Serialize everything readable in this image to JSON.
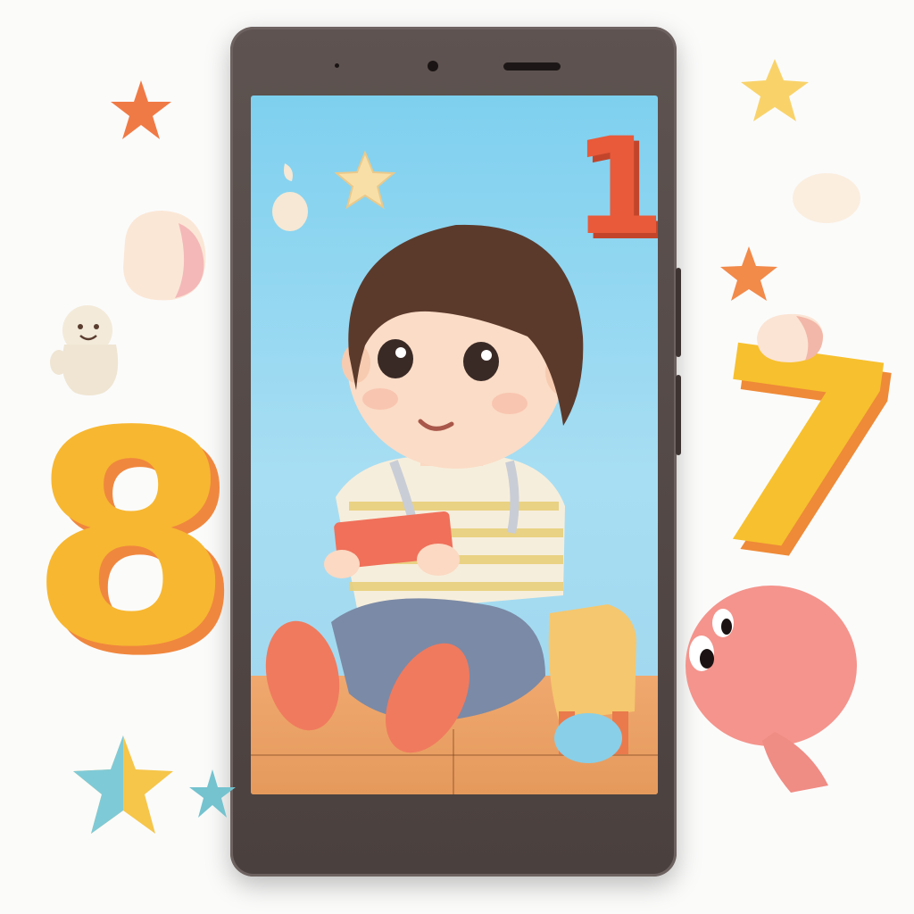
{
  "scene": {
    "description_colors": {
      "background": "#fbfbfa",
      "phone_body": "#4a403e",
      "screen_sky": "#8fd5f0",
      "floor": "#eca064",
      "digit_orange_yellow": "#f7b731",
      "digit_red": "#e85a3a"
    },
    "digits": {
      "left": "8",
      "right": "7",
      "screen": "1"
    },
    "icons": [
      "star-icon",
      "star-icon",
      "star-icon",
      "star-icon",
      "star-icon",
      "star-icon",
      "star-icon",
      "toy-ghost-icon",
      "balloon-creature-icon",
      "marshmallow-icon"
    ]
  }
}
